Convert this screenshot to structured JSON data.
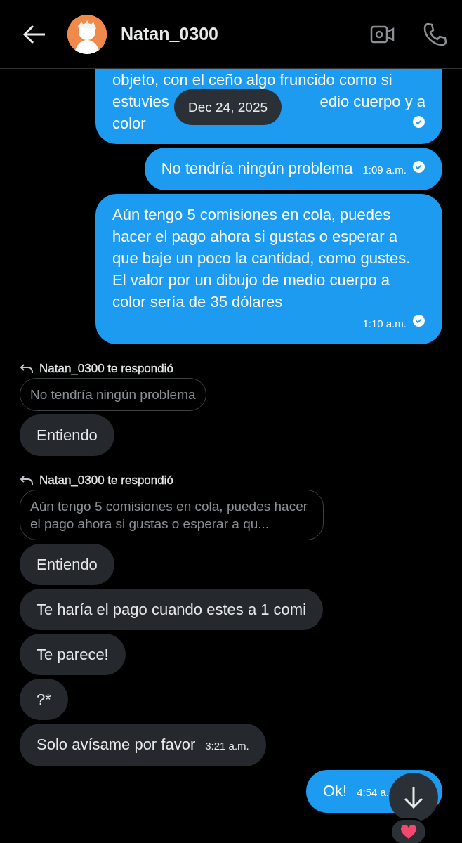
{
  "header": {
    "title": "Natan_0300"
  },
  "date_pill": "Dec 24, 2025",
  "messages": [
    {
      "kind": "sent_cut",
      "lines": [
        [
          "objeto, con el ceño algo fruncido como si"
        ],
        [
          "estuvies",
          "edio cuerpo y a"
        ],
        [
          "color"
        ]
      ],
      "read": true
    },
    {
      "kind": "sent",
      "text": "No tendría ningún problema",
      "time": "1:09 a.m.",
      "read": true
    },
    {
      "kind": "sent",
      "text": "Aún tengo 5 comisiones en cola, puedes hacer el pago ahora si gustas o esperar a que baje un poco la cantidad, como gustes. El valor por un dibujo de medio cuerpo a color sería de 35 dólares",
      "time": "1:10 a.m.",
      "read": true
    },
    {
      "kind": "reply",
      "label": "Natan_0300 te respondió",
      "quote": "No tendría ningún problema"
    },
    {
      "kind": "received",
      "text": "Entiendo"
    },
    {
      "kind": "reply",
      "label": "Natan_0300 te respondió",
      "quote": "Aún tengo 5 comisiones en cola, puedes hacer el pago ahora si gustas o esperar a qu..."
    },
    {
      "kind": "received",
      "text": "Entiendo"
    },
    {
      "kind": "received",
      "text": "Te haría el pago cuando estes a 1 comi"
    },
    {
      "kind": "received",
      "text": "Te parece!"
    },
    {
      "kind": "received",
      "text": "?*"
    },
    {
      "kind": "received",
      "text": "Solo avísame por favor",
      "time": "3:21 a.m."
    },
    {
      "kind": "sent",
      "text": "Ok!",
      "time": "4:54 a.",
      "read": false,
      "reacted": true
    }
  ]
}
